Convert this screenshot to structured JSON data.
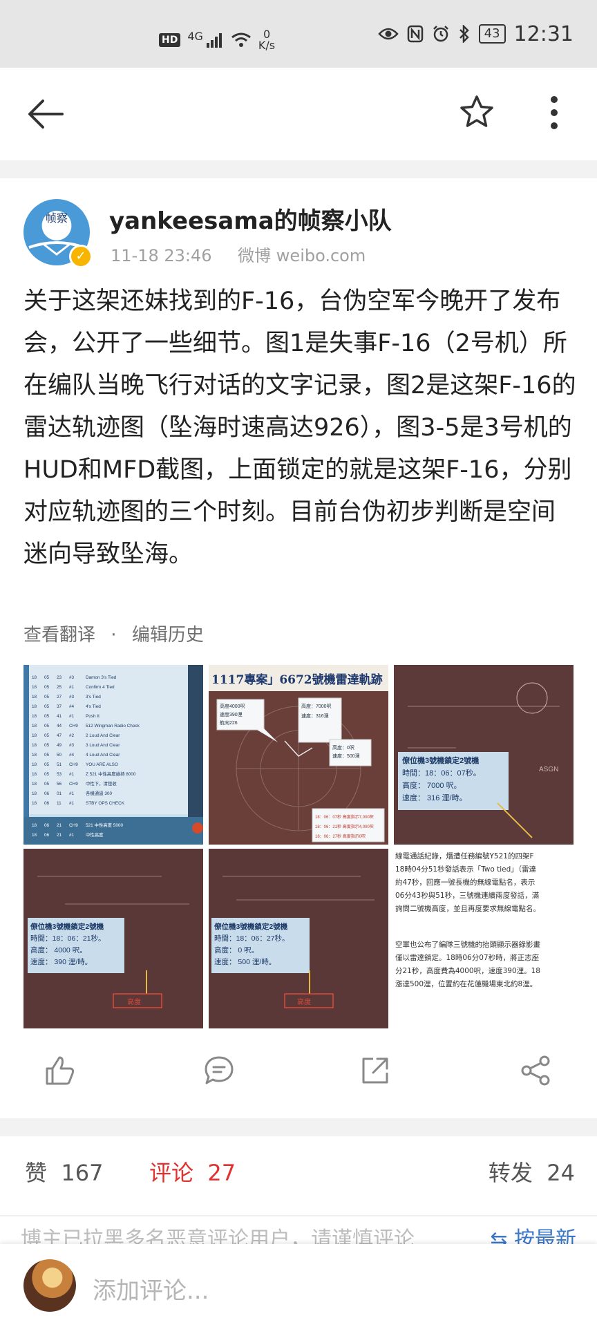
{
  "status_bar": {
    "hd": "HD",
    "signal": "4G",
    "net_speed_value": "0",
    "net_speed_unit": "K/s",
    "battery": "43",
    "time": "12:31"
  },
  "toolbar": {
    "back_icon": "arrow-left-icon",
    "favorite_icon": "star-outline-icon",
    "more_icon": "more-vertical-icon"
  },
  "post": {
    "author_name": "yankeesama的帧察小队",
    "avatar_text": "帧察",
    "timestamp": "11-18 23:46",
    "source": "微博 weibo.com",
    "text": "关于这架还妹找到的F-16，台伪空军今晚开了发布会，公开了一些细节。图1是失事F-16（2号机）所在编队当晚飞行对话的文字记录，图2是这架F-16的雷达轨迹图（坠海时速高达926），图3-5是3号机的HUD和MFD截图，上面锁定的就是这架F-16，分别对应轨迹图的三个时刻。目前台伪初步判断是空间迷向导致坠海。",
    "translate_label": "查看翻译",
    "separator": "·",
    "edit_history_label": "编辑历史"
  },
  "images": {
    "img1": {
      "rows": [
        [
          "18",
          "05",
          "23",
          "#3",
          "Damon 3's Tied"
        ],
        [
          "18",
          "05",
          "25",
          "#1",
          "Confirm 4 Tied"
        ],
        [
          "18",
          "05",
          "27",
          "#3",
          "3's Tied"
        ],
        [
          "18",
          "05",
          "37",
          "#4",
          "4's Tied"
        ],
        [
          "18",
          "05",
          "41",
          "#1",
          "Push It"
        ],
        [
          "18",
          "05",
          "44",
          "CH9",
          "512 Wingman Radio Check"
        ],
        [
          "18",
          "05",
          "47",
          "#2",
          "2 Loud And Clear"
        ],
        [
          "18",
          "05",
          "49",
          "#3",
          "3 Loud And Clear"
        ],
        [
          "18",
          "05",
          "50",
          "#4",
          "4 Loud And Clear"
        ],
        [
          "18",
          "05",
          "51",
          "CH9",
          "YOU ARE ALSO"
        ],
        [
          "18",
          "05",
          "53",
          "#1",
          "Z 521 中性高度維持 8000"
        ],
        [
          "18",
          "05",
          "56",
          "CH9",
          "中性下，清楚收"
        ],
        [
          "18",
          "06",
          "01",
          "#1",
          "各機通過 300"
        ],
        [
          "18",
          "06",
          "11",
          "#1",
          "STBY OPS CHECK"
        ]
      ],
      "footer_rows": [
        [
          "18",
          "06",
          "21",
          "CH9",
          "521 中性高度 5000"
        ],
        [
          "18",
          "06",
          "21",
          "#1",
          "中性高度"
        ]
      ]
    },
    "img2": {
      "title": "1117專案」6672號機雷達軌跡",
      "box1": [
        "高度4000呎",
        "速度390浬",
        "航向226"
      ],
      "box2": [
        "高度：7000呎",
        "速度：316浬"
      ],
      "box3": [
        "高度：0呎",
        "速度：500浬"
      ],
      "legend": [
        "18：06：07秒 高度指示7,000呎",
        "18：06：21秒 高度指示4,000呎",
        "18：06：27秒 高度指示0呎"
      ]
    },
    "img3": {
      "title": "僚位機3號機鎖定2號機",
      "time": "時間：18：06：07秒。",
      "alt": "高度： 7000 呎。",
      "speed": "速度： 316 浬/時。",
      "hud_tag": "ASGN"
    },
    "img4": {
      "title": "僚位機3號機鎖定2號機",
      "time": "時間：18：06：21秒。",
      "alt": "高度： 4000 呎。",
      "speed": "速度： 390 浬/時。",
      "hud_tag": "高度"
    },
    "img5": {
      "title": "僚位機3號機鎖定2號機",
      "time": "時間：18：06：27秒。",
      "alt": "高度： 0 呎。",
      "speed": "速度： 500 浬/時。",
      "hud_tag": "高度"
    },
    "img6": {
      "para1": [
        "線電通話紀錄，熸遭任務編號Y521的四架F",
        "18時04分51秒發話表示「Two tied」（雷達",
        "約47秒，回應一號長機的無線電點名，表示",
        "06分43秒與51秒，三號機連續兩度發話，滿",
        "詢問二號機高度，並且再度要求無線電點名。"
      ],
      "para2": [
        "空軍也公布了編隊三號機的抬頭顯示器錄影畫",
        "僅以雷達鎖定。18時06分07秒時，將正志座",
        "分21秒，高度費為4000呎，速度390浬。18",
        "漲達500浬，位置約在花蓮機場東北約8浬。"
      ]
    }
  },
  "actions": {
    "like_icon": "thumb-up-icon",
    "comment_icon": "comment-icon",
    "repost_icon": "repost-icon",
    "share_icon": "share-icon"
  },
  "stats": {
    "like_label": "赞",
    "like_count": "167",
    "comment_label": "评论",
    "comment_count": "27",
    "repost_label": "转发",
    "repost_count": "24"
  },
  "comments": {
    "notice": "博主已拉黑多名恶意评论用户，请谨慎评论",
    "sort_label": "按最新"
  },
  "comment_bar": {
    "placeholder": "添加评论..."
  }
}
